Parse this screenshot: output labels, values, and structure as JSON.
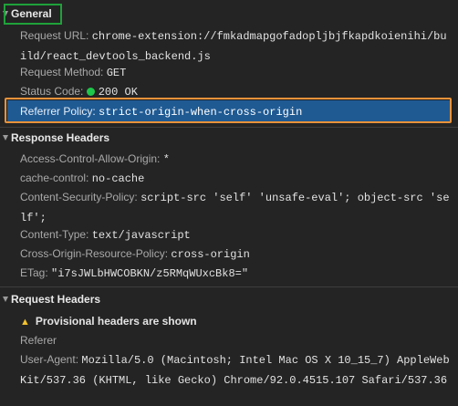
{
  "general": {
    "title": "General",
    "request_url_key": "Request URL:",
    "request_url_value": "chrome-extension://fmkadmapgofadopljbjfkapdkoienihi/build/react_devtools_backend.js",
    "request_method_key": "Request Method:",
    "request_method_value": "GET",
    "status_code_key": "Status Code:",
    "status_code_value": "200 OK",
    "status_color": "#1ec84a",
    "referrer_policy_key": "Referrer Policy:",
    "referrer_policy_value": "strict-origin-when-cross-origin"
  },
  "response_headers": {
    "title": "Response Headers",
    "items": [
      {
        "key": "Access-Control-Allow-Origin:",
        "value": "*"
      },
      {
        "key": "cache-control:",
        "value": "no-cache"
      },
      {
        "key": "Content-Security-Policy:",
        "value": "script-src 'self' 'unsafe-eval'; object-src 'self';"
      },
      {
        "key": "Content-Type:",
        "value": "text/javascript"
      },
      {
        "key": "Cross-Origin-Resource-Policy:",
        "value": "cross-origin"
      },
      {
        "key": "ETag:",
        "value": "\"i7sJWLbHWCOBKN/z5RMqWUxcBk8=\""
      }
    ]
  },
  "request_headers": {
    "title": "Request Headers",
    "warning": "Provisional headers are shown",
    "referer_key": "Referer",
    "user_agent_key": "User-Agent:",
    "user_agent_value": "Mozilla/5.0 (Macintosh; Intel Mac OS X 10_15_7) AppleWebKit/537.36 (KHTML, like Gecko) Chrome/92.0.4515.107 Safari/537.36"
  },
  "colors": {
    "highlight": "#1f5a93",
    "orange_outline": "#e8923a",
    "green_outline": "#1fa13a",
    "warning": "#f2c12e"
  }
}
